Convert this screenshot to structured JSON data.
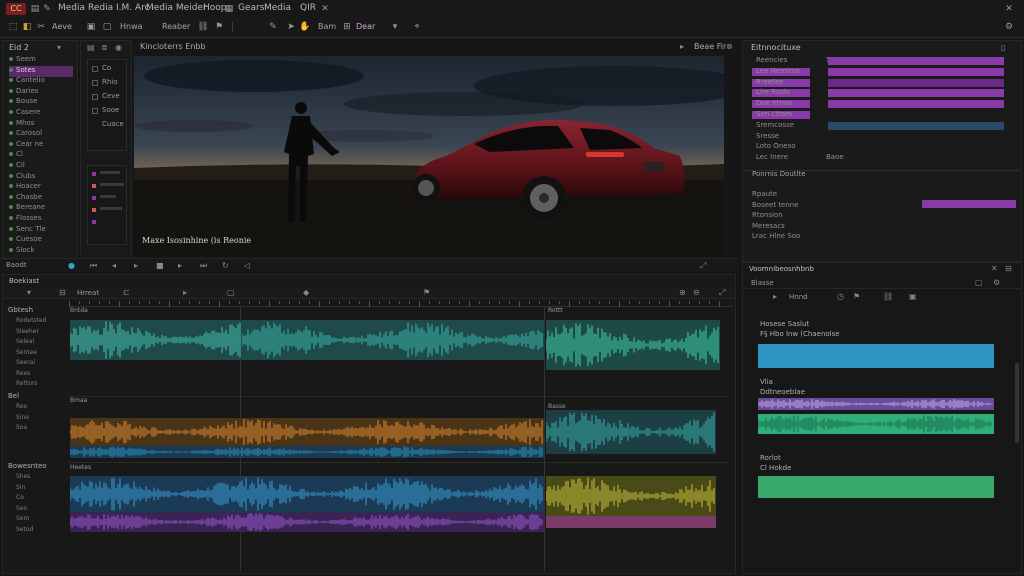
{
  "menubar": {
    "logo_label": "CC",
    "items": [
      "Media",
      "Redia I.M. Arc",
      "Media Meider",
      "Hoop",
      "Gears",
      "Media",
      "QIR"
    ],
    "toolbar2": [
      "Aeve",
      "Hnwa",
      "Reaber",
      "Bam",
      "Dear"
    ]
  },
  "media_pool": {
    "title": "Eid 2",
    "items": [
      {
        "label": "Seem",
        "selected": false
      },
      {
        "label": "Sotes",
        "selected": true
      },
      {
        "label": "Cantelio",
        "selected": false
      },
      {
        "label": "Daries",
        "selected": false
      },
      {
        "label": "Bouse",
        "selected": false
      },
      {
        "label": "Casere",
        "selected": false
      },
      {
        "label": "Mhos",
        "selected": false
      },
      {
        "label": "Carosol",
        "selected": false
      },
      {
        "label": "Cear ne",
        "selected": false
      },
      {
        "label": "Cl",
        "selected": false
      },
      {
        "label": "Cil",
        "selected": false
      },
      {
        "label": "Clubs",
        "selected": false
      },
      {
        "label": "Hoacer",
        "selected": false
      },
      {
        "label": "Chasbe",
        "selected": false
      },
      {
        "label": "Bereane",
        "selected": false
      },
      {
        "label": "Flosses",
        "selected": false
      },
      {
        "label": "Senc Tle",
        "selected": false
      },
      {
        "label": "Cuesoe",
        "selected": false
      },
      {
        "label": "Slock",
        "selected": false
      }
    ],
    "sub_items": [
      "Co",
      "Rhio",
      "Ceve",
      "Sooe",
      "Cuace"
    ],
    "bin_label": "Baodt"
  },
  "viewer": {
    "title": "Kincloterrs Enbb",
    "overlay_text": "Maxe Isosinhine (is Reonie",
    "zoom_label": "Beae Fir"
  },
  "inspector": {
    "title": "Eitnnocituxe",
    "rows": [
      {
        "label": "Reencies",
        "value": "5"
      },
      {
        "label": "Lee Hemitse",
        "value": ""
      },
      {
        "label": "Rreetee",
        "value": ""
      },
      {
        "label": "Lire Rsole",
        "value": ""
      },
      {
        "label": "Doe ntnos",
        "value": ""
      },
      {
        "label": "Sen cttom",
        "value": ""
      },
      {
        "label": "Sremcosse",
        "value": ""
      },
      {
        "label": "Sresse",
        "value": ""
      },
      {
        "label": "Loto Oneso",
        "value": ""
      },
      {
        "label": "Lec Inere",
        "value": "Baoe"
      }
    ],
    "effects_title": "Ponrnis Doutlte",
    "effects": [
      "Rpaute",
      "Boseet tenne",
      "Rtonsion",
      "Meresacs",
      "Lrac Hlne Soo"
    ]
  },
  "timeline": {
    "title": "Boekiast",
    "zoom": "Hrreat",
    "track_headers": [
      {
        "group": "Gbtesh",
        "rows": [
          "Rodetsted",
          "Sleeher",
          "Seleal",
          "Sentee",
          "Seeral",
          "Rees",
          "Rettors"
        ]
      },
      {
        "group": "Bel",
        "rows": [
          "Reo",
          "Sine",
          "Soa"
        ]
      },
      {
        "group": "Bowesnteo",
        "rows": [
          "Shes",
          "Sin",
          "Co",
          "Seo",
          "Sem",
          "Setod"
        ]
      }
    ],
    "clip_labels": [
      "Bntda",
      "Rottt",
      "Bmaa",
      "Basse",
      "Heetes"
    ]
  },
  "right_timeline": {
    "title": "Voomnibeosnhbnb",
    "header": "Blasse",
    "sub": "Hnnd",
    "clips": [
      {
        "label": "Hosese Saslut",
        "sub": "F§ Hbo lnw (Chaenolse",
        "color": "#2f94c4"
      },
      {
        "label": "Vlia",
        "sub": "Ddtneoeblae",
        "color": "#2fae7a"
      },
      {
        "label": "Rorlot",
        "sub": "Cl Hokde",
        "color": "#36a86a"
      }
    ]
  },
  "colors": {
    "accent_purple": "#8a3aa8",
    "teal": "#2a9a8a",
    "blue": "#2f94c4",
    "orange": "#c8782a",
    "green": "#36a86a"
  }
}
